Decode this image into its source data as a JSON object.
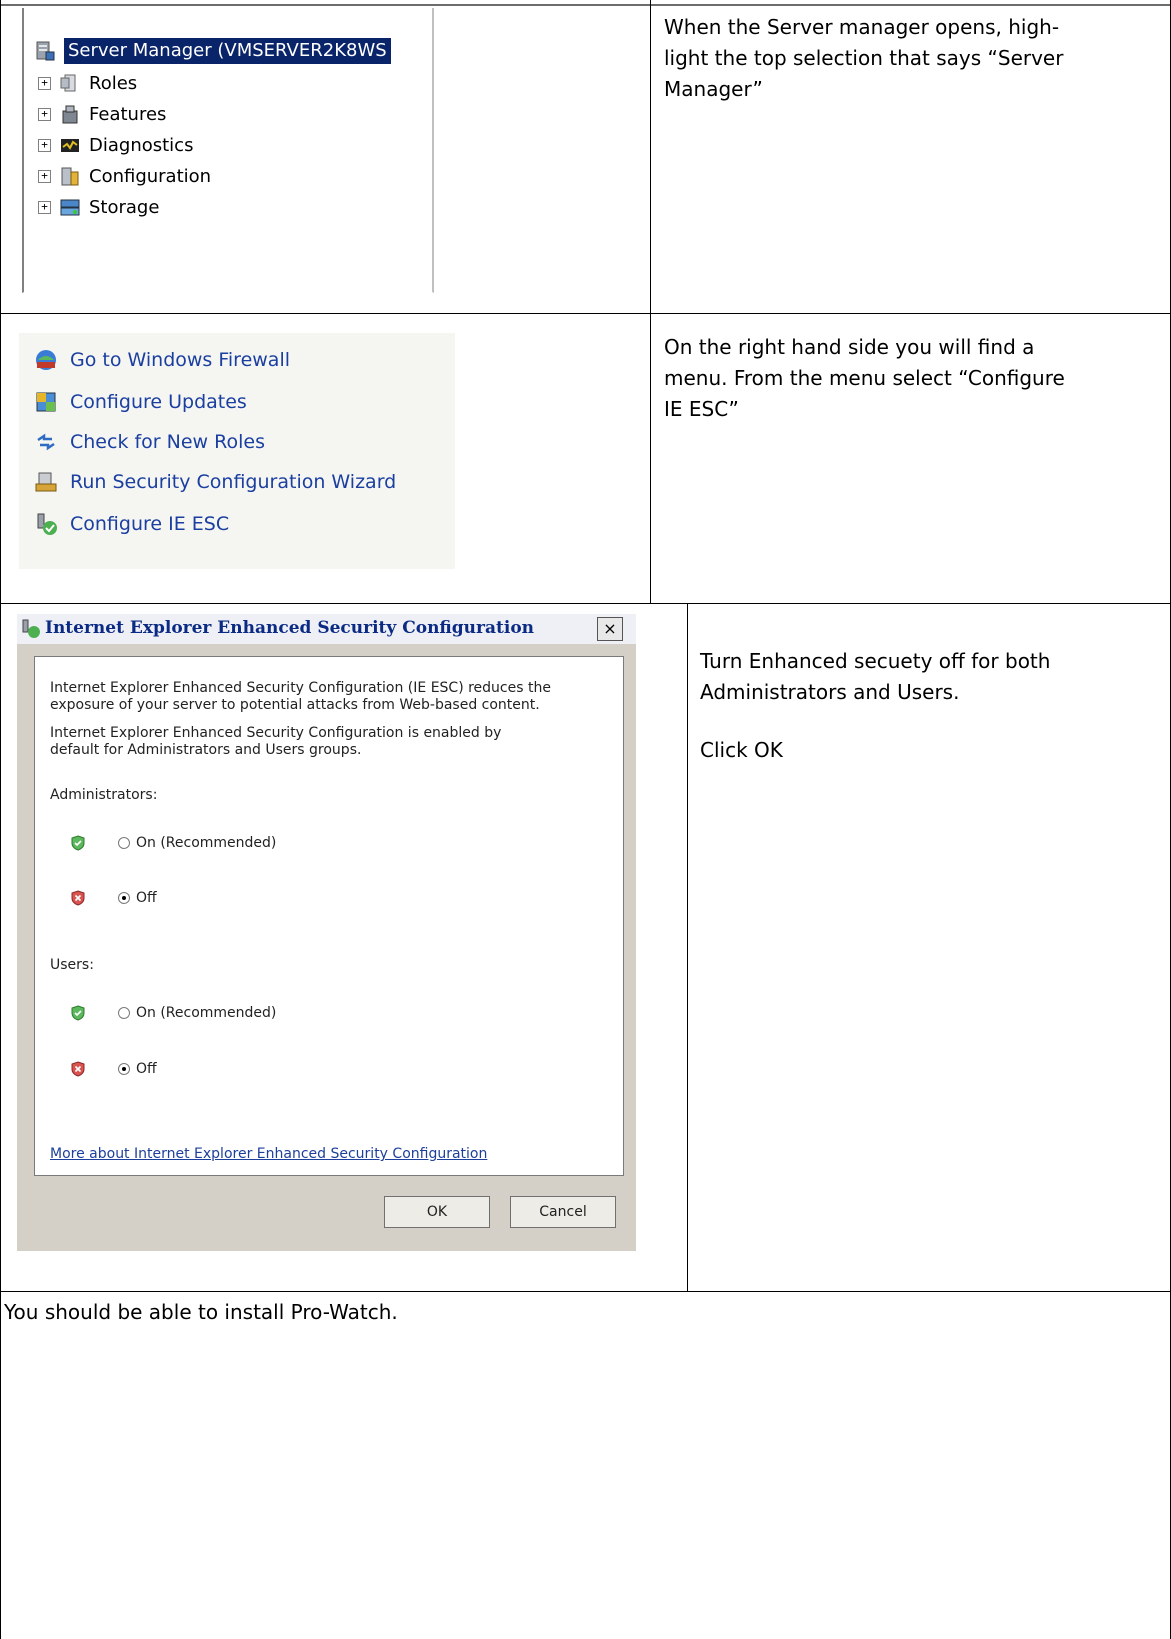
{
  "rows": {
    "server_manager": {
      "instruction": [
        "When the Server manager opens, high-",
        "light the top selection that says “Server",
        "Manager”"
      ],
      "tree": {
        "root": "Server Manager (VMSERVER2K8WS",
        "items": [
          "Roles",
          "Features",
          "Diagnostics",
          "Configuration",
          "Storage"
        ],
        "expander_glyph": "+"
      }
    },
    "menu": {
      "instruction": [
        "On the right hand side you will find a",
        "menu. From the menu select “Configure",
        "IE ESC”"
      ],
      "items": [
        "Go to Windows Firewall",
        "Configure Updates",
        "Check for New Roles",
        "Run Security Configuration Wizard",
        "Configure IE ESC"
      ]
    },
    "dialog": {
      "instruction": [
        "Turn Enhanced secuety off for both",
        "Administrators and Users."
      ],
      "instruction_2": "Click OK",
      "title": "Internet Explorer Enhanced Security Configuration",
      "close_glyph": "×",
      "para1": [
        "Internet Explorer Enhanced Security Configuration (IE ESC) reduces the",
        "exposure of your server to potential attacks from Web-based content."
      ],
      "para2": [
        "Internet Explorer Enhanced Security Configuration is enabled by",
        "default for Administrators and Users groups."
      ],
      "admins_label": "Administrators:",
      "users_label": "Users:",
      "option_on": "On (Recommended)",
      "option_off": "Off",
      "admins_selected": "Off",
      "users_selected": "Off",
      "link": "More about Internet Explorer Enhanced Security Configuration",
      "ok": "OK",
      "cancel": "Cancel"
    },
    "final": {
      "text": "You should be able to install Pro-Watch."
    }
  }
}
